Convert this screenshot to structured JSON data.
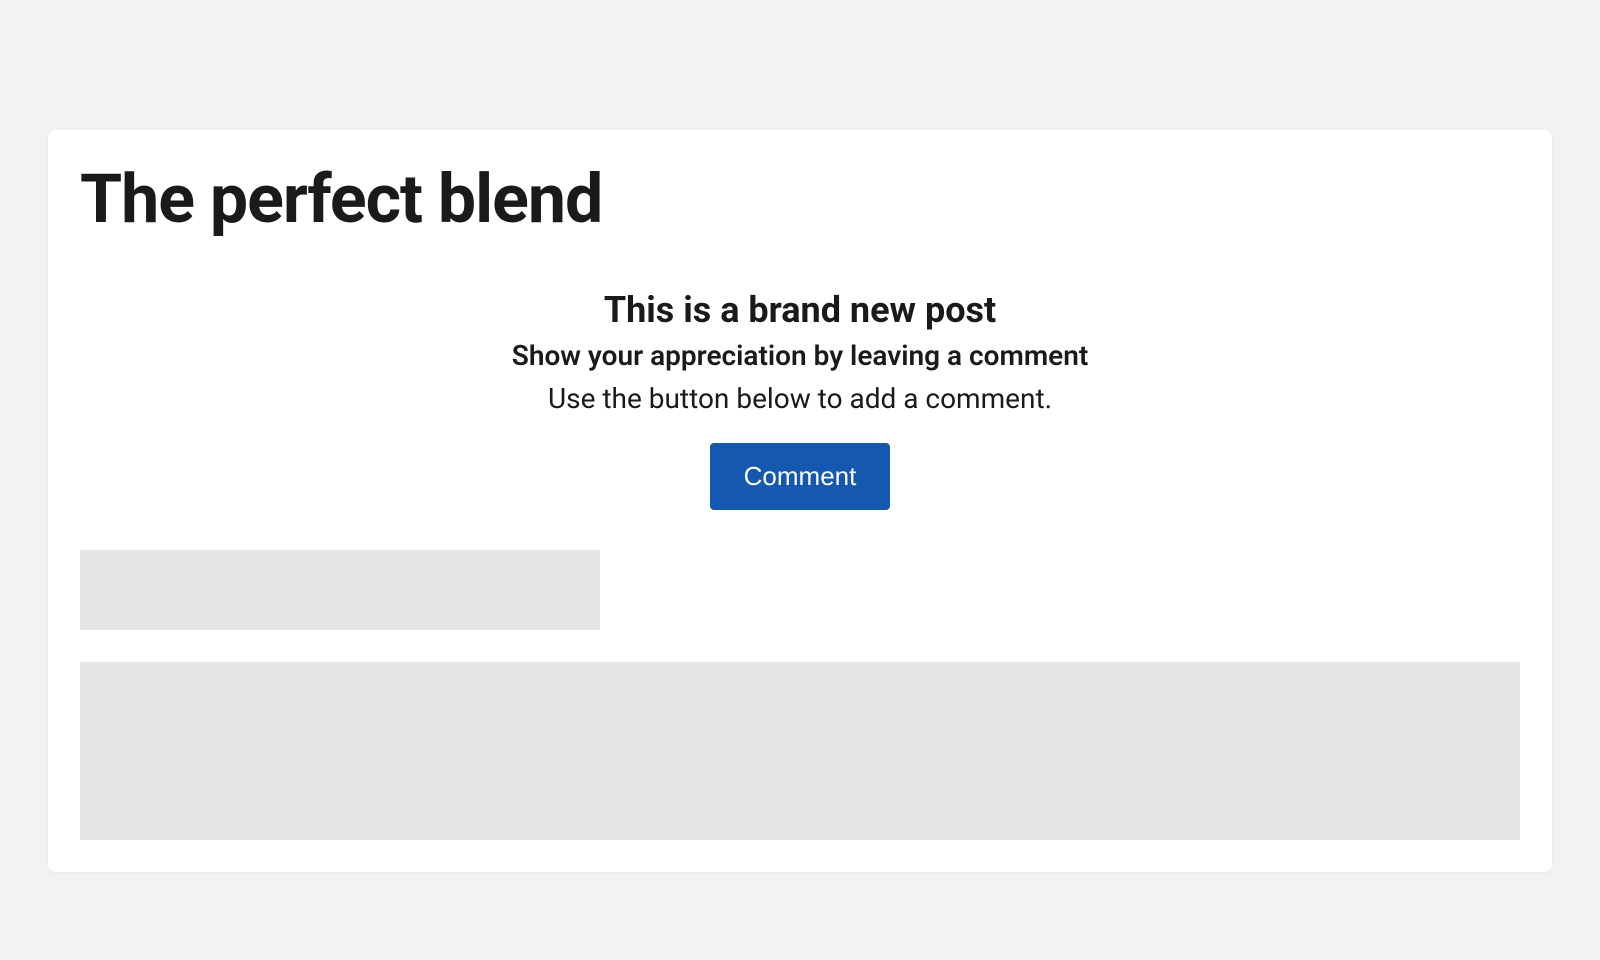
{
  "header": {
    "title": "The perfect blend"
  },
  "emptyState": {
    "heading": "This is a brand new post",
    "subheading": "Show your appreciation by leaving a comment",
    "description": "Use the button below to add a comment.",
    "buttonLabel": "Comment"
  }
}
